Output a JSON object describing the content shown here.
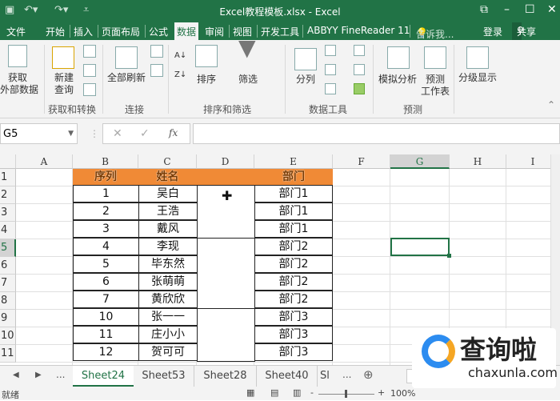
{
  "window": {
    "title": "Excel教程模板.xlsx - Excel"
  },
  "tabs": [
    {
      "label": "文件"
    },
    {
      "label": "开始"
    },
    {
      "label": "插入"
    },
    {
      "label": "页面布局"
    },
    {
      "label": "公式"
    },
    {
      "label": "数据",
      "active": true
    },
    {
      "label": "审阅"
    },
    {
      "label": "视图"
    },
    {
      "label": "开发工具"
    },
    {
      "label": "ABBYY FineReader 11"
    }
  ],
  "tellme": "告诉我...",
  "login": "登录",
  "share": "共享",
  "ribbon": {
    "get_external": "获取\n外部数据",
    "new_query": "新建\n查询",
    "refresh_all": "全部刷新",
    "sort": "排序",
    "filter": "筛选",
    "text_to_columns": "分列",
    "what_if": "模拟分析",
    "forecast_sheet": "预测\n工作表",
    "outline": "分级显示",
    "groups": [
      "获取和转换",
      "连接",
      "排序和筛选",
      "数据工具",
      "预测"
    ]
  },
  "formula_bar": {
    "name_box": "G5",
    "fx": "fx",
    "value": ""
  },
  "columns": [
    "A",
    "B",
    "C",
    "D",
    "E",
    "F",
    "G",
    "H",
    "I"
  ],
  "rows": [
    "1",
    "2",
    "3",
    "4",
    "5",
    "6",
    "7",
    "8",
    "9",
    "10",
    "11"
  ],
  "table": {
    "headers": [
      "序列",
      "姓名",
      "部门"
    ],
    "rows": [
      [
        "1",
        "吴白",
        "部门1"
      ],
      [
        "2",
        "王浩",
        "部门1"
      ],
      [
        "3",
        "戴风",
        "部门1"
      ],
      [
        "4",
        "李现",
        "部门2"
      ],
      [
        "5",
        "毕东然",
        "部门2"
      ],
      [
        "6",
        "张萌萌",
        "部门2"
      ],
      [
        "7",
        "黄欣欣",
        "部门2"
      ],
      [
        "10",
        "张一一",
        "部门3"
      ],
      [
        "11",
        "庄小小",
        "部门3"
      ],
      [
        "12",
        "贺可可",
        "部门3"
      ]
    ]
  },
  "sheets": [
    {
      "label": "Sheet24",
      "active": true
    },
    {
      "label": "Sheet53"
    },
    {
      "label": "Sheet28"
    },
    {
      "label": "Sheet40"
    },
    {
      "label": "Sl"
    }
  ],
  "sheet_more": "...",
  "status": {
    "ready": "就绪",
    "zoom": "100%"
  },
  "watermark": {
    "text": "查询啦",
    "domain": "chaxunla.com"
  },
  "colors": {
    "accent": "#217346",
    "header_fill": "#f08a36"
  }
}
